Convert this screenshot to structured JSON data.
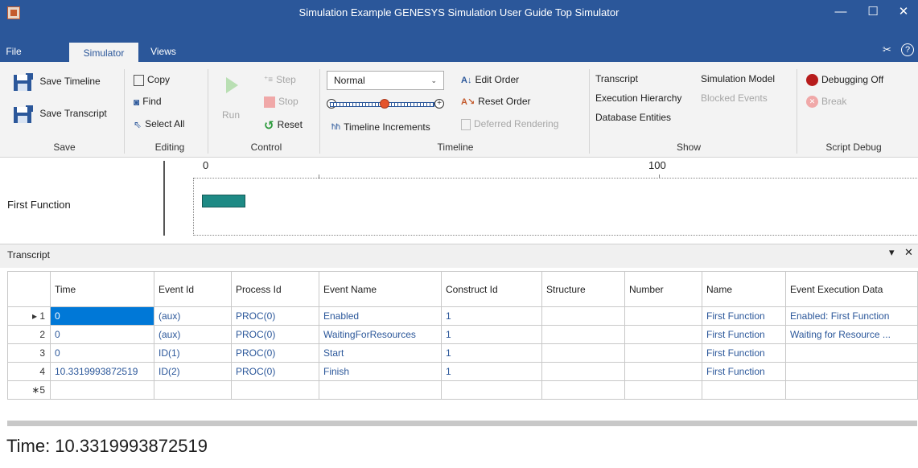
{
  "window": {
    "title": "Simulation Example GENESYS Simulation User Guide Top Simulator",
    "minimize_glyph": "—",
    "maximize_glyph": "☐",
    "close_glyph": "✕"
  },
  "tabs": [
    {
      "label": "File"
    },
    {
      "label": "Simulator"
    },
    {
      "label": "Views"
    }
  ],
  "ribbon": {
    "save": {
      "save_timeline": "Save Timeline",
      "save_transcript": "Save Transcript",
      "group": "Save"
    },
    "editing": {
      "copy": "Copy",
      "find": "Find",
      "select_all": "Select All",
      "group": "Editing"
    },
    "control": {
      "run": "Run",
      "step": "Step",
      "stop": "Stop",
      "reset": "Reset",
      "group": "Control"
    },
    "timeline": {
      "speed_value": "Normal",
      "timeline_increments": "Timeline Increments",
      "edit_order": "Edit Order",
      "reset_order": "Reset Order",
      "deferred_rendering": "Deferred Rendering",
      "group": "Timeline"
    },
    "show": {
      "transcript": "Transcript",
      "simulation_model": "Simulation Model",
      "execution_hierarchy": "Execution Hierarchy",
      "blocked_events": "Blocked Events",
      "database_entities": "Database Entities",
      "group": "Show"
    },
    "script_debug": {
      "debugging_off": "Debugging Off",
      "break": "Break",
      "group": "Script Debug"
    }
  },
  "timeline_view": {
    "tick_0": "0",
    "tick_100": "100",
    "row_label": "First Function"
  },
  "transcript": {
    "title": "Transcript",
    "pin_glyph": "▾",
    "close_glyph": "✕",
    "columns": [
      "Time",
      "Event Id",
      "Process Id",
      "Event Name",
      "Construct Id",
      "Structure",
      "Number",
      "Name",
      "Event Execution Data"
    ],
    "rows": [
      {
        "num": "▸ 1",
        "time": "0",
        "event_id": "(aux)",
        "process_id": "PROC(0)",
        "event_name": "Enabled",
        "construct_id": "1",
        "structure": "",
        "number": "",
        "name": "First Function",
        "exec_data": "Enabled: First Function"
      },
      {
        "num": "2",
        "time": "0",
        "event_id": "(aux)",
        "process_id": "PROC(0)",
        "event_name": "WaitingForResources",
        "construct_id": "1",
        "structure": "",
        "number": "",
        "name": "First Function",
        "exec_data": "Waiting for Resource ..."
      },
      {
        "num": "3",
        "time": "0",
        "event_id": "ID(1)",
        "process_id": "PROC(0)",
        "event_name": "Start",
        "construct_id": "1",
        "structure": "",
        "number": "",
        "name": "First Function",
        "exec_data": ""
      },
      {
        "num": "4",
        "time": "10.3319993872519",
        "event_id": "ID(2)",
        "process_id": "PROC(0)",
        "event_name": "Finish",
        "construct_id": "1",
        "structure": "",
        "number": "",
        "name": "First Function",
        "exec_data": ""
      },
      {
        "num": "∗5",
        "time": "",
        "event_id": "",
        "process_id": "",
        "event_name": "",
        "construct_id": "",
        "structure": "",
        "number": "",
        "name": "",
        "exec_data": ""
      }
    ]
  },
  "status": {
    "time_text": "Time: 10.3319993872519"
  },
  "colors": {
    "title_bar": "#2b579a",
    "ribbon_bg": "#f3f3f3",
    "timeline_bar": "#1e8a85",
    "selection": "#0078d7",
    "link_text": "#2b579a"
  }
}
